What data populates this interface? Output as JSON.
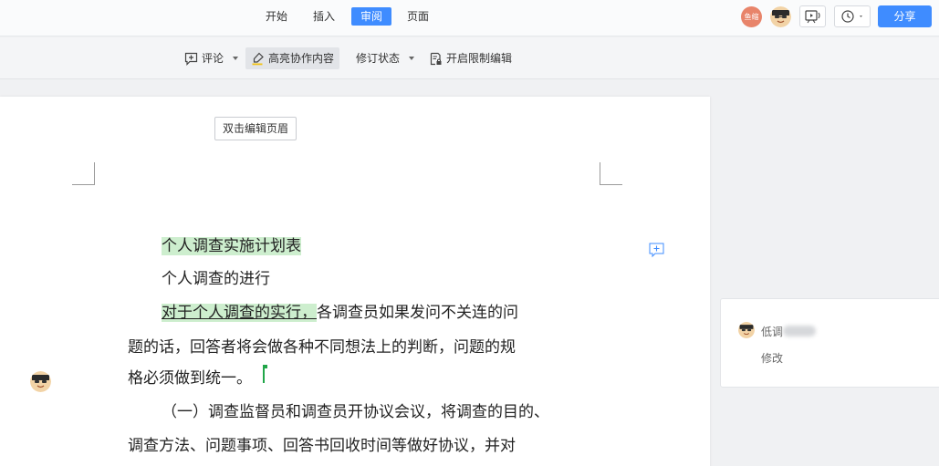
{
  "menu": {
    "tabs": [
      {
        "label": "开始"
      },
      {
        "label": "插入"
      },
      {
        "label": "审阅"
      },
      {
        "label": "页面"
      }
    ],
    "active_tab": "审阅"
  },
  "toolbar": {
    "user_avatar_label": "鱼缩",
    "share_label": "分享"
  },
  "ribbon": {
    "comment_label": "评论",
    "highlight_label": "高亮协作内容",
    "revision_label": "修订状态",
    "restrict_label": "开启限制编辑"
  },
  "document": {
    "header_hint": "双击编辑页眉",
    "lines": {
      "title": "个人调查实施计划表",
      "subtitle": "个人调查的进行",
      "p1_highlight": "对于个人调查的实行，",
      "p1_rest": "各调查员如果发问不关连的问",
      "p2": "题的话，回答者将会做各种不同想法上的判断，问题的规",
      "p3": "格必须做到统一。",
      "p4": "（一）调查监督员和调查员开协议会议，将调查的目的、",
      "p5": "调查方法、问题事项、回答书回收时间等做好协议，并对"
    }
  },
  "comment": {
    "author_visible": "低调",
    "action": "修改"
  },
  "colors": {
    "accent": "#3f8cff",
    "highlight": "#cdeece",
    "cursor": "#21a649",
    "avatar_bg": "#e8846a"
  }
}
